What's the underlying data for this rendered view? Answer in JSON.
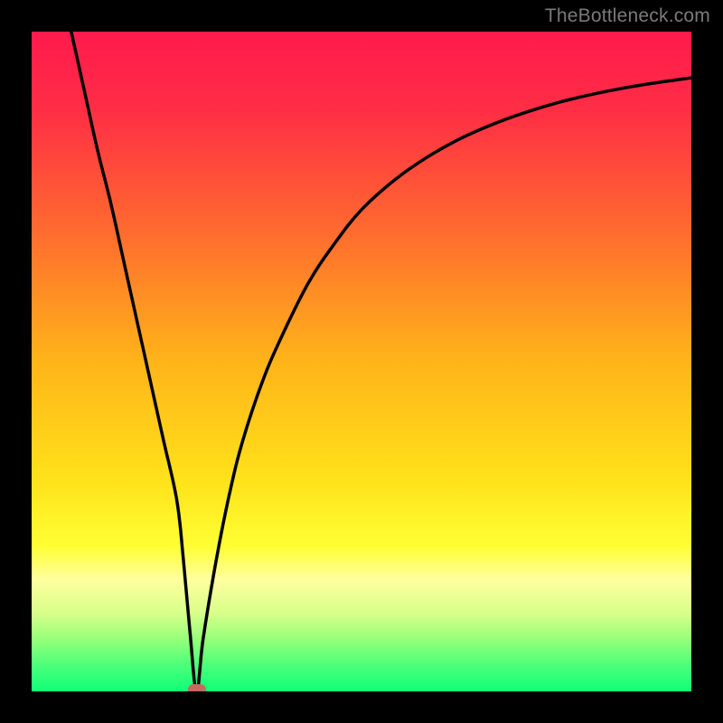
{
  "watermark": "TheBottleneck.com",
  "gradient_stops": [
    {
      "pct": 0,
      "color": "#ff1a4d"
    },
    {
      "pct": 12,
      "color": "#ff2e45"
    },
    {
      "pct": 30,
      "color": "#ff6a2f"
    },
    {
      "pct": 50,
      "color": "#ffb419"
    },
    {
      "pct": 68,
      "color": "#ffe21a"
    },
    {
      "pct": 78,
      "color": "#ffff34"
    },
    {
      "pct": 83,
      "color": "#ffff9e"
    },
    {
      "pct": 88,
      "color": "#d9ff8a"
    },
    {
      "pct": 92,
      "color": "#98ff7a"
    },
    {
      "pct": 96,
      "color": "#4dff7a"
    },
    {
      "pct": 100,
      "color": "#0fff78"
    }
  ],
  "chart_data": {
    "type": "line",
    "title": "",
    "xlabel": "",
    "ylabel": "",
    "xlim": [
      0,
      100
    ],
    "ylim": [
      0,
      100
    ],
    "grid": false,
    "legend_position": "none",
    "series": [
      {
        "name": "curve",
        "x": [
          6,
          8,
          10,
          12,
          14,
          16,
          18,
          20,
          22,
          23,
          24,
          25,
          26,
          28,
          30,
          32,
          35,
          38,
          42,
          46,
          50,
          55,
          60,
          65,
          70,
          75,
          80,
          85,
          90,
          95,
          100
        ],
        "values": [
          100,
          91,
          82,
          74,
          65,
          56,
          47,
          38,
          29,
          20,
          9,
          0,
          8,
          20,
          30,
          38,
          47,
          54,
          62,
          68,
          73,
          77.5,
          81,
          83.8,
          86,
          87.8,
          89.3,
          90.5,
          91.5,
          92.3,
          93
        ]
      }
    ],
    "marker": {
      "x": 25,
      "y": 0
    },
    "annotations": []
  }
}
